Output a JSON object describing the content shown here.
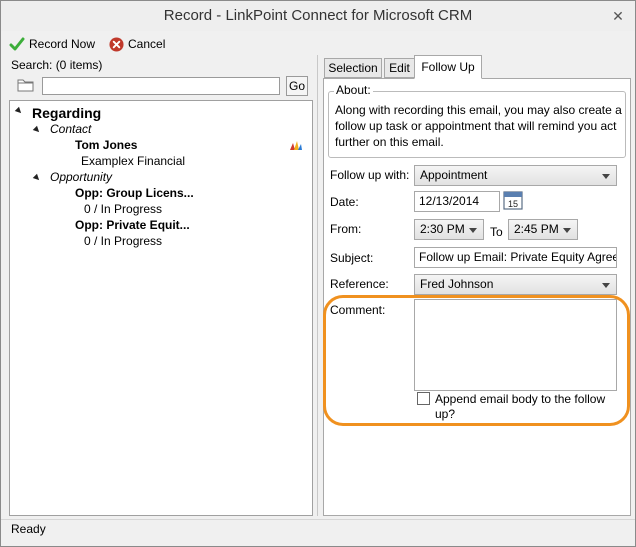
{
  "window": {
    "title": "Record - LinkPoint Connect for Microsoft CRM",
    "close": "✕"
  },
  "toolbar": {
    "record_now": "Record Now",
    "cancel": "Cancel"
  },
  "search": {
    "label": "Search: (0 items)",
    "value": "",
    "go": "Go"
  },
  "tree": {
    "regarding": "Regarding",
    "contact_group": "Contact",
    "contact_name": "Tom Jones",
    "contact_company": "Examplex Financial",
    "opportunity_group": "Opportunity",
    "opp1_name": "Opp: Group Licens...",
    "opp1_status": "0 / In Progress",
    "opp2_name": "Opp: Private Equit...",
    "opp2_status": "0 / In Progress"
  },
  "tabs": [
    {
      "label": "Selection"
    },
    {
      "label": "Edit"
    },
    {
      "label": "Follow Up"
    }
  ],
  "followup": {
    "about_title": "About:",
    "about_text": "Along with recording this email, you may also create a follow up task or appointment that will remind you act further on this email.",
    "follow_up_with_label": "Follow up with:",
    "follow_up_with_value": "Appointment",
    "date_label": "Date:",
    "date_value": "12/13/2014",
    "calendar_day": "15",
    "from_label": "From:",
    "from_value": "2:30 PM",
    "to_label": "To",
    "to_value": "2:45 PM",
    "subject_label": "Subject:",
    "subject_value": "Follow up Email: Private Equity Agreement",
    "reference_label": "Reference:",
    "reference_value": "Fred Johnson",
    "comment_label": "Comment:",
    "comment_value": "",
    "append_label": "Append email body to the follow up?"
  },
  "status": {
    "text": "Ready"
  },
  "colors": {
    "highlight": "#f0911f",
    "record_green": "#3cae3a",
    "cancel_red": "#c0392b"
  }
}
